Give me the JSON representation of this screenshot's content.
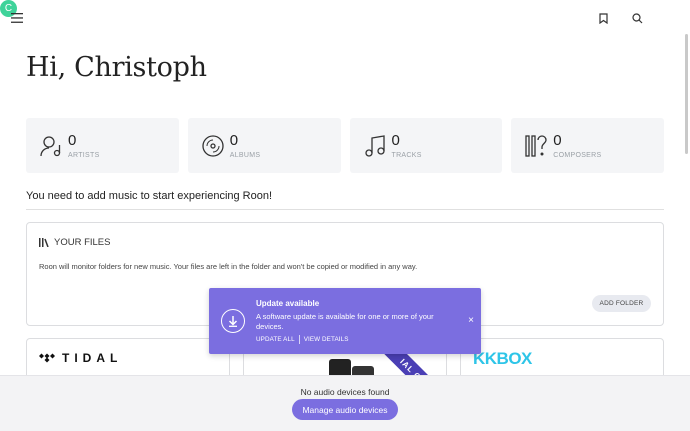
{
  "header": {
    "avatar_initial": "C"
  },
  "greeting": "Hi, Christoph",
  "stats": [
    {
      "value": "0",
      "label": "ARTISTS",
      "icon": "artist-icon"
    },
    {
      "value": "0",
      "label": "ALBUMS",
      "icon": "album-icon"
    },
    {
      "value": "0",
      "label": "TRACKS",
      "icon": "track-icon"
    },
    {
      "value": "0",
      "label": "COMPOSERS",
      "icon": "composer-icon"
    }
  ],
  "notice": "You need to add music to start experiencing Roon!",
  "files": {
    "title": "YOUR FILES",
    "description": "Roon will monitor folders for new music. Your files are left in the folder and won't be copied or modified in any way.",
    "add_folder_label": "ADD FOLDER"
  },
  "services": {
    "tidal_label": "TIDAL",
    "ribbon_label": "IAL OF",
    "kkbox_label": "KKBOX"
  },
  "toast": {
    "title": "Update available",
    "body": "A software update is available for one or more of your devices.",
    "update_all_label": "UPDATE ALL",
    "view_details_label": "VIEW DETAILS",
    "close_label": "×"
  },
  "bottom": {
    "no_devices_text": "No audio devices found",
    "manage_label": "Manage audio devices"
  },
  "colors": {
    "accent": "#7b6ee0",
    "avatar": "#3fd39a",
    "kkbox": "#2ec5e8"
  }
}
